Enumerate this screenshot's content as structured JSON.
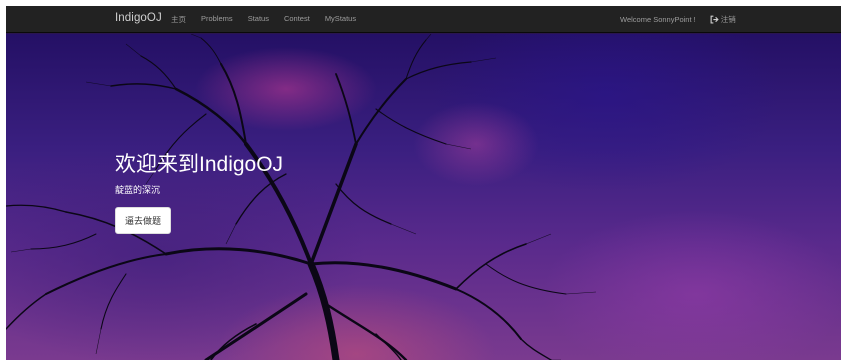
{
  "navbar": {
    "brand": "IndigoOJ",
    "links": [
      {
        "label": "主页"
      },
      {
        "label": "Problems"
      },
      {
        "label": "Status"
      },
      {
        "label": "Contest"
      },
      {
        "label": "MyStatus"
      }
    ],
    "welcome": "Welcome SonnyPoint !",
    "logout_label": "注销",
    "logout_icon": "logout-icon"
  },
  "hero": {
    "title": "欢迎来到IndigoOJ",
    "subtitle": "靛蓝的深沉",
    "button_label": "逼去做题"
  },
  "colors": {
    "navbar_bg": "#222222",
    "nav_text": "#9d9d9d",
    "hero_text": "#ffffff",
    "button_bg": "#ffffff"
  }
}
